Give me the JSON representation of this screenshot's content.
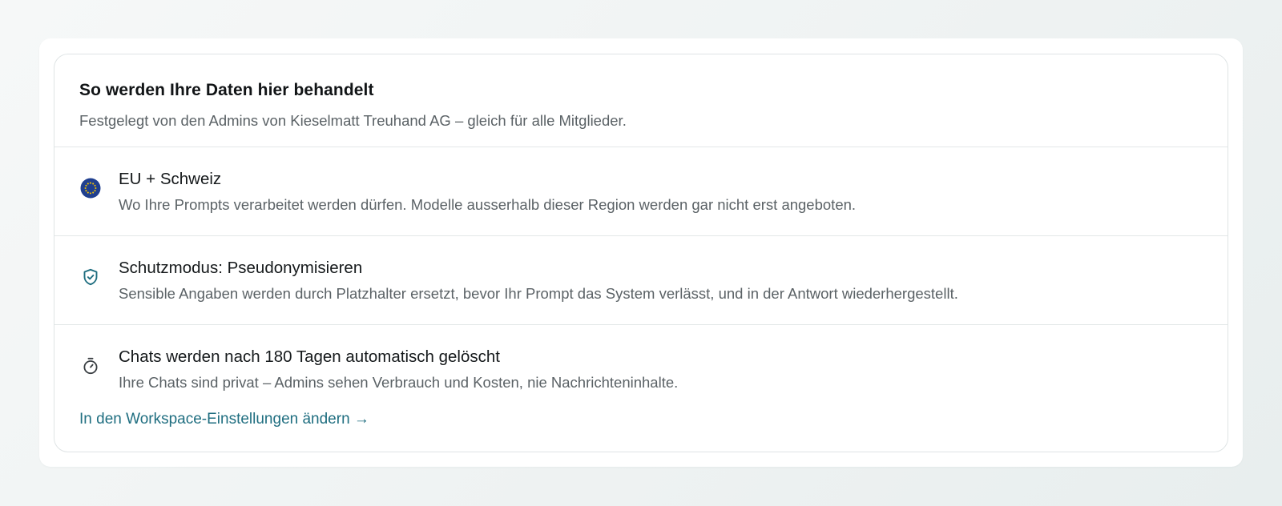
{
  "header": {
    "title": "So werden Ihre Daten hier behandelt",
    "subtitle": "Festgelegt von den Admins von Kieselmatt Treuhand AG – gleich für alle Mitglieder."
  },
  "items": [
    {
      "icon": "eu-flag-icon",
      "title": "EU + Schweiz",
      "description": "Wo Ihre Prompts verarbeitet werden dürfen. Modelle ausserhalb dieser Region werden gar nicht erst angeboten."
    },
    {
      "icon": "shield-check-icon",
      "title": "Schutzmodus: Pseudonymisieren",
      "description": "Sensible Angaben werden durch Platzhalter ersetzt, bevor Ihr Prompt das System verlässt, und in der Antwort wiederhergestellt."
    },
    {
      "icon": "stopwatch-icon",
      "title": "Chats werden nach 180 Tagen automatisch gelöscht",
      "description": "Ihre Chats sind privat – Admins sehen Verbrauch und Kosten, nie Nachrichteninhalte."
    }
  ],
  "footer": {
    "link_label": "In den Workspace-Einstellungen ändern →"
  },
  "colors": {
    "accent": "#1f6e80",
    "eu_blue": "#1f3f8f",
    "eu_gold": "#f2c200"
  }
}
